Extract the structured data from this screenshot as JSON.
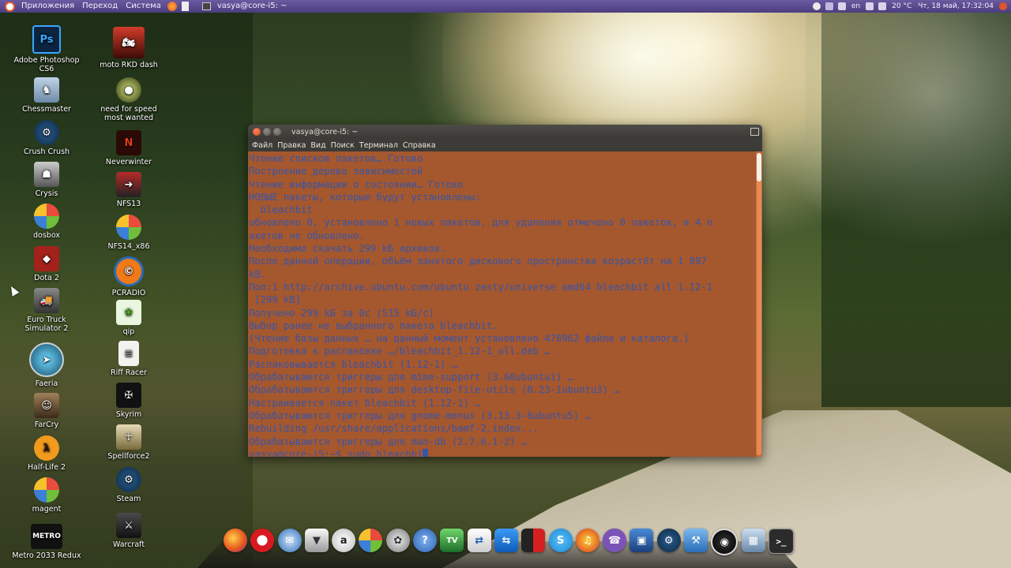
{
  "top_panel": {
    "menus": [
      "Приложения",
      "Переход",
      "Система"
    ],
    "active_window": "vasya@core-i5: ~",
    "tray": {
      "lang": "en",
      "temperature": "20 °C",
      "datetime": "Чт, 18 май, 17:32:04"
    }
  },
  "desktop": {
    "col1": [
      "Adobe Photoshop CS6",
      "Chessmaster",
      "Crush Crush",
      "Crysis",
      "dosbox",
      "Dota 2",
      "Euro Truck Simulator 2",
      "Faeria",
      "FarCry",
      "Half-Life 2",
      "magent",
      "Metro 2033 Redux"
    ],
    "col2": [
      "moto RKD dash",
      "need for speed most wanted",
      "Neverwinter",
      "NFS13",
      "NFS14_x86",
      "PCRADIO",
      "qip",
      "Riff Racer",
      "Skyrim",
      "Spellforce2",
      "Steam",
      "Warcraft"
    ]
  },
  "terminal": {
    "title": "vasya@core-i5: ~",
    "menu": [
      "Файл",
      "Правка",
      "Вид",
      "Поиск",
      "Терминал",
      "Справка"
    ],
    "lines": [
      "Чтение списков пакетов… Готово",
      "Построение дерева зависимостей",
      "Чтение информации о состоянии… Готово",
      "НОВЫЕ пакеты, которые будут установлены:",
      "  bleachbit",
      "обновлено 0, установлено 1 новых пакетов, для удаления отмечено 0 пакетов, и 4 п",
      "акетов не обновлено.",
      "Необходимо скачать 299 kБ архивов.",
      "После данной операции, объём занятого дискового пространства возрастёт на 1 897",
      "kB.",
      "Пол:1 http://archive.ubuntu.com/ubuntu zesty/universe amd64 bleachbit all 1.12-1",
      " [299 kB]",
      "Получено 299 kБ за 0с (515 kБ/c)",
      "Выбор ранее не выбранного пакета bleachbit.",
      "(Чтение базы данных … на данный момент установлено 478962 файла и каталога.)",
      "Подготовка к распаковке …/bleachbit_1.12-1_all.deb …",
      "Распаковывается bleachbit (1.12-1) …",
      "Обрабатываются триггеры для mime-support (3.60ubuntu1) …",
      "Обрабатываются триггеры для desktop-file-utils (0.23-1ubuntu3) …",
      "Настраивается пакет bleachbit (1.12-1) …",
      "Обрабатываются триггеры для gnome-menus (3.13.3-6ubuntu5) …",
      "Rebuilding /usr/share/applications/bamf-2.index...",
      "Обрабатываются триггеры для man-db (2.7.6.1-2) …"
    ],
    "prompt": "vasya@core-i5:~$ sudo bleachbi"
  },
  "dock": {
    "items": [
      "firefox",
      "opera",
      "thunderbird",
      "wolf-app",
      "aimp",
      "picasa",
      "reel-app",
      "help",
      "tv",
      "teamviewer-share",
      "teamviewer",
      "nero",
      "skype-beta",
      "audio-app",
      "viber",
      "virtualbox",
      "steam",
      "tools",
      "obs",
      "screenshot",
      "terminal"
    ]
  }
}
